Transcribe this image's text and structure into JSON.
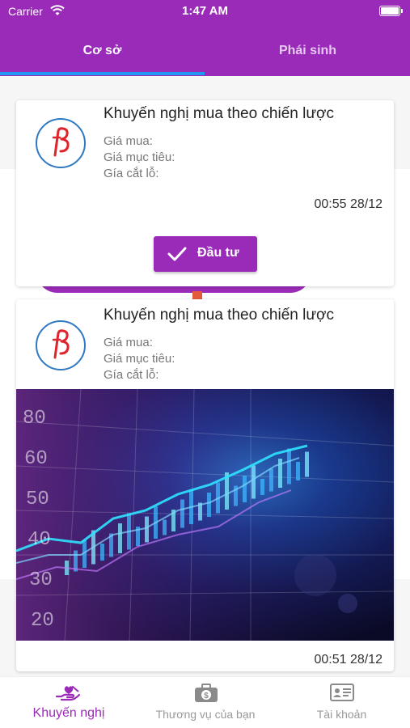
{
  "status_bar": {
    "carrier": "Carrier",
    "time": "1:47 AM"
  },
  "tabs": [
    {
      "label": "Cơ sở",
      "active": true
    },
    {
      "label": "Phái sinh",
      "active": false
    }
  ],
  "cards": [
    {
      "title": "Khuyến nghị mua theo chiến lược",
      "buy_price_label": "Giá mua:",
      "target_price_label": "Giá mục tiêu:",
      "stop_loss_label": "Gía cắt lỗ:",
      "time": "00:55 28/12",
      "action_label": "Đầu tư"
    },
    {
      "title": "Khuyến nghị mua theo chiến lược",
      "buy_price_label": "Giá mua:",
      "target_price_label": "Giá mục tiêu:",
      "stop_loss_label": "Gía cắt lỗ:",
      "time": "00:51 28/12",
      "image_axis_numbers": [
        "80",
        "60",
        "50",
        "40",
        "30",
        "20"
      ]
    }
  ],
  "bottom_nav": [
    {
      "label": "Khuyến nghị",
      "icon": "hand-heart-icon",
      "active": true
    },
    {
      "label": "Thương vụ của bạn",
      "icon": "briefcase-dollar-icon",
      "active": false
    },
    {
      "label": "Tài khoản",
      "icon": "id-card-icon",
      "active": false
    }
  ],
  "colors": {
    "primary": "#9a2bb8",
    "tab_indicator": "#2196f3",
    "logo_ring": "#2f79c2",
    "logo_mark": "#e0242c"
  }
}
